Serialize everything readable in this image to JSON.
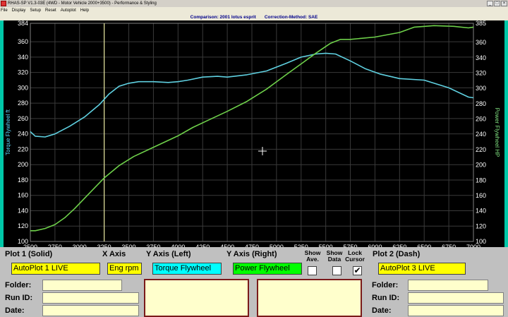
{
  "window": {
    "title": "RHAS-SP V1.3-03E (4WD - Motor Vehicle 2000+3500) - Performance & Styling",
    "minimize": "_",
    "maximize": "□",
    "close": "×"
  },
  "menu": [
    {
      "label": "File"
    },
    {
      "label": "Display"
    },
    {
      "label": "Setup"
    },
    {
      "label": "Reset"
    },
    {
      "label": "Autoplot"
    },
    {
      "label": "Help"
    }
  ],
  "comparison": {
    "label": "Comparison: 2001 lotus esprit",
    "correction": "Correction-Method: SAE"
  },
  "chart_data": {
    "type": "line",
    "xlim": [
      2500,
      7000
    ],
    "ylim_left": [
      100,
      384
    ],
    "ylim_right": [
      100,
      385
    ],
    "x_ticks": [
      2500,
      2750,
      3000,
      3250,
      3500,
      3750,
      4000,
      4250,
      4500,
      4750,
      5000,
      5250,
      5500,
      5750,
      6000,
      6250,
      6500,
      6750,
      7000
    ],
    "y_ticks_left": [
      100,
      120,
      140,
      160,
      180,
      200,
      220,
      240,
      260,
      280,
      300,
      320,
      340,
      360,
      384
    ],
    "y_ticks_right": [
      100,
      120,
      140,
      160,
      180,
      200,
      220,
      240,
      260,
      280,
      300,
      320,
      340,
      360,
      385
    ],
    "ylabel_left": "Torque Flywheel ft",
    "ylabel_right": "Power Flywheel HP",
    "grid": true,
    "cursor_x": 3250,
    "series": [
      {
        "axis": "left",
        "color": "#5fd0e0",
        "x": [
          2500,
          2550,
          2650,
          2750,
          2900,
          3050,
          3200,
          3300,
          3400,
          3500,
          3600,
          3750,
          3900,
          4000,
          4100,
          4250,
          4400,
          4500,
          4700,
          4900,
          5100,
          5250,
          5400,
          5500,
          5600,
          5750,
          5900,
          6050,
          6250,
          6500,
          6750,
          6950,
          7000
        ],
        "values": [
          243,
          237,
          236,
          240,
          250,
          262,
          278,
          292,
          302,
          306,
          308,
          308,
          307,
          308,
          310,
          314,
          315,
          314,
          317,
          322,
          332,
          340,
          344,
          345,
          344,
          335,
          325,
          318,
          312,
          310,
          300,
          288,
          287
        ]
      },
      {
        "axis": "right",
        "color": "#6ed04a",
        "x": [
          2500,
          2550,
          2650,
          2750,
          2850,
          2950,
          3100,
          3250,
          3400,
          3550,
          3700,
          3850,
          4000,
          4150,
          4300,
          4500,
          4700,
          4900,
          5100,
          5250,
          5400,
          5550,
          5650,
          5750,
          6000,
          6250,
          6400,
          6600,
          6800,
          6950,
          7000
        ],
        "values": [
          114,
          114,
          117,
          122,
          131,
          143,
          163,
          183,
          199,
          211,
          220,
          229,
          238,
          249,
          258,
          270,
          283,
          299,
          318,
          332,
          346,
          359,
          364,
          364,
          367,
          373,
          380,
          382,
          381,
          379,
          380
        ]
      }
    ]
  },
  "controls": {
    "plot1_label": "Plot 1 (Solid)",
    "plot1_value": "AutoPlot 1 LIVE",
    "xaxis_label": "X Axis",
    "xaxis_value": "Eng rpm",
    "yleft_label": "Y Axis (Left)",
    "yleft_value": "Torque Flywheel",
    "yright_label": "Y Axis (Right)",
    "yright_value": "Power Flywheel",
    "show_ave_line1": "Show",
    "show_ave_line2": "Ave.",
    "show_data_line1": "Show",
    "show_data_line2": "Data",
    "lock_cursor_line1": "Lock",
    "lock_cursor_line2": "Cursor",
    "lock_cursor_check": "✔",
    "plot2_label": "Plot 2 (Dash)",
    "plot2_value": "AutoPlot 3 LIVE",
    "folder_label": "Folder:",
    "runid_label": "Run ID:",
    "date_label": "Date:",
    "folder2_label": "Folder:",
    "runid2_label": "Run ID:",
    "date2_label": "Date:"
  }
}
